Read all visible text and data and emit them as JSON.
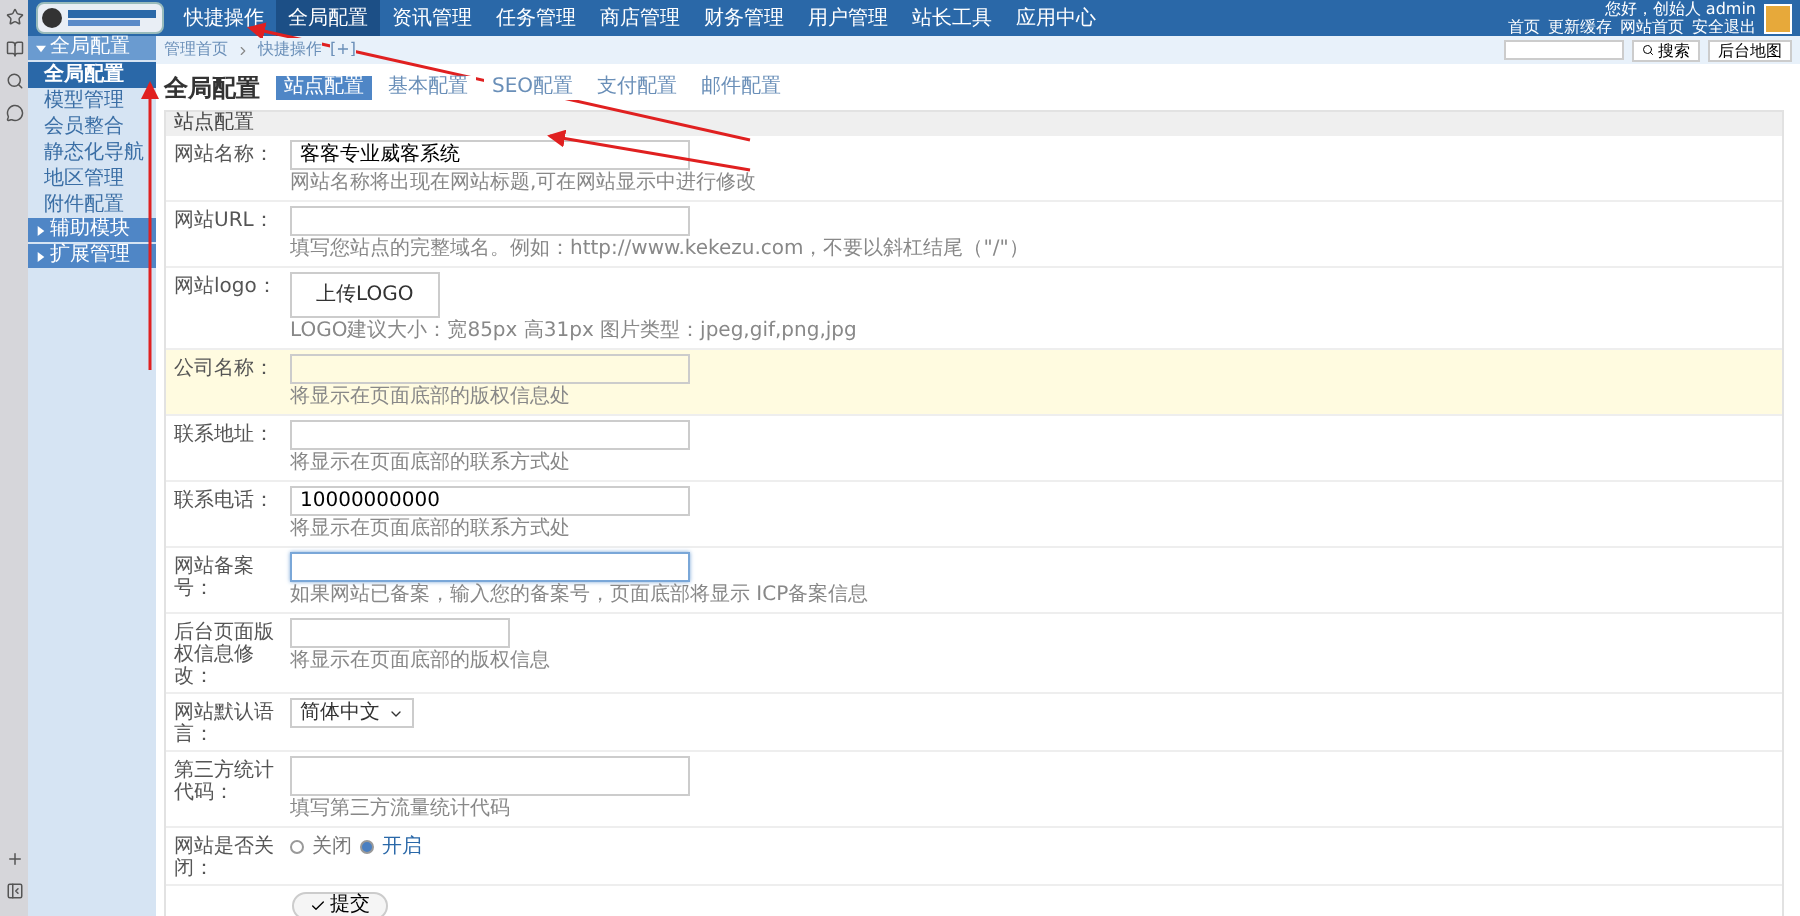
{
  "nav": [
    {
      "label": "快捷操作",
      "selected": false
    },
    {
      "label": "全局配置",
      "selected": true
    },
    {
      "label": "资讯管理",
      "selected": false
    },
    {
      "label": "任务管理",
      "selected": false
    },
    {
      "label": "商店管理",
      "selected": false
    },
    {
      "label": "财务管理",
      "selected": false
    },
    {
      "label": "用户管理",
      "selected": false
    },
    {
      "label": "站长工具",
      "selected": false
    },
    {
      "label": "应用中心",
      "selected": false
    }
  ],
  "user": {
    "greeting": "您好，创始人 admin",
    "links": [
      "首页",
      "更新缓存",
      "网站首页",
      "安全退出"
    ]
  },
  "breadcrumb": [
    "管理首页",
    "快捷操作",
    "[+]"
  ],
  "search": {
    "button": "搜索",
    "map_button": "后台地图"
  },
  "sidebar": [
    {
      "label": "全局配置",
      "expanded": true,
      "children": [
        {
          "label": "全局配置",
          "selected": true
        },
        {
          "label": "模型管理",
          "selected": false
        },
        {
          "label": "会员整合",
          "selected": false
        },
        {
          "label": "静态化导航",
          "selected": false
        },
        {
          "label": "地区管理",
          "selected": false
        },
        {
          "label": "附件配置",
          "selected": false
        }
      ]
    },
    {
      "label": "辅助模块",
      "expanded": false
    },
    {
      "label": "扩展管理",
      "expanded": false
    }
  ],
  "page_title": "全局配置",
  "tabs": [
    {
      "label": "站点配置",
      "selected": true
    },
    {
      "label": "基本配置",
      "selected": false
    },
    {
      "label": "SEO配置",
      "selected": false
    },
    {
      "label": "支付配置",
      "selected": false
    },
    {
      "label": "邮件配置",
      "selected": false
    }
  ],
  "section_title": "站点配置",
  "rows": [
    {
      "kind": "input",
      "label": "网站名称：",
      "value": "客客专业威客系统",
      "hint": "网站名称将出现在网站标题,可在网站显示中进行修改",
      "highlighted": false,
      "focused": false
    },
    {
      "kind": "input",
      "label": "网站URL：",
      "hint": "填写您站点的完整域名。例如：http://www.kekezu.com，不要以斜杠结尾（\"/\"）",
      "highlighted": false,
      "focused": false
    },
    {
      "kind": "upload",
      "label": "网站logo：",
      "button": "上传LOGO",
      "hint": "LOGO建议大小：宽85px 高31px 图片类型：jpeg,gif,png,jpg",
      "highlighted": false
    },
    {
      "kind": "input",
      "label": "公司名称：",
      "hint": "将显示在页面底部的版权信息处",
      "highlighted": true,
      "focused": false
    },
    {
      "kind": "input",
      "label": "联系地址：",
      "hint": "将显示在页面底部的联系方式处",
      "highlighted": false,
      "focused": false
    },
    {
      "kind": "input",
      "label": "联系电话：",
      "value": "10000000000",
      "hint": "将显示在页面底部的联系方式处",
      "highlighted": false,
      "focused": false
    },
    {
      "kind": "input",
      "label": "网站备案号：",
      "hint": "如果网站已备案，输入您的备案号，页面底部将显示 ICP备案信息",
      "highlighted": false,
      "focused": true
    },
    {
      "kind": "short_input",
      "label": "后台页面版权信息修改：",
      "hint": "将显示在页面底部的版权信息",
      "highlighted": false
    },
    {
      "kind": "select",
      "label": "网站默认语言：",
      "value": "简体中文",
      "highlighted": false
    },
    {
      "kind": "textarea",
      "label": "第三方统计代码：",
      "hint": "填写第三方流量统计代码",
      "highlighted": false
    },
    {
      "kind": "radio",
      "label": "网站是否关闭：",
      "options": [
        {
          "label": "关闭",
          "selected": false
        },
        {
          "label": "开启",
          "selected": true
        }
      ],
      "highlighted": false
    }
  ],
  "submit": "提交"
}
